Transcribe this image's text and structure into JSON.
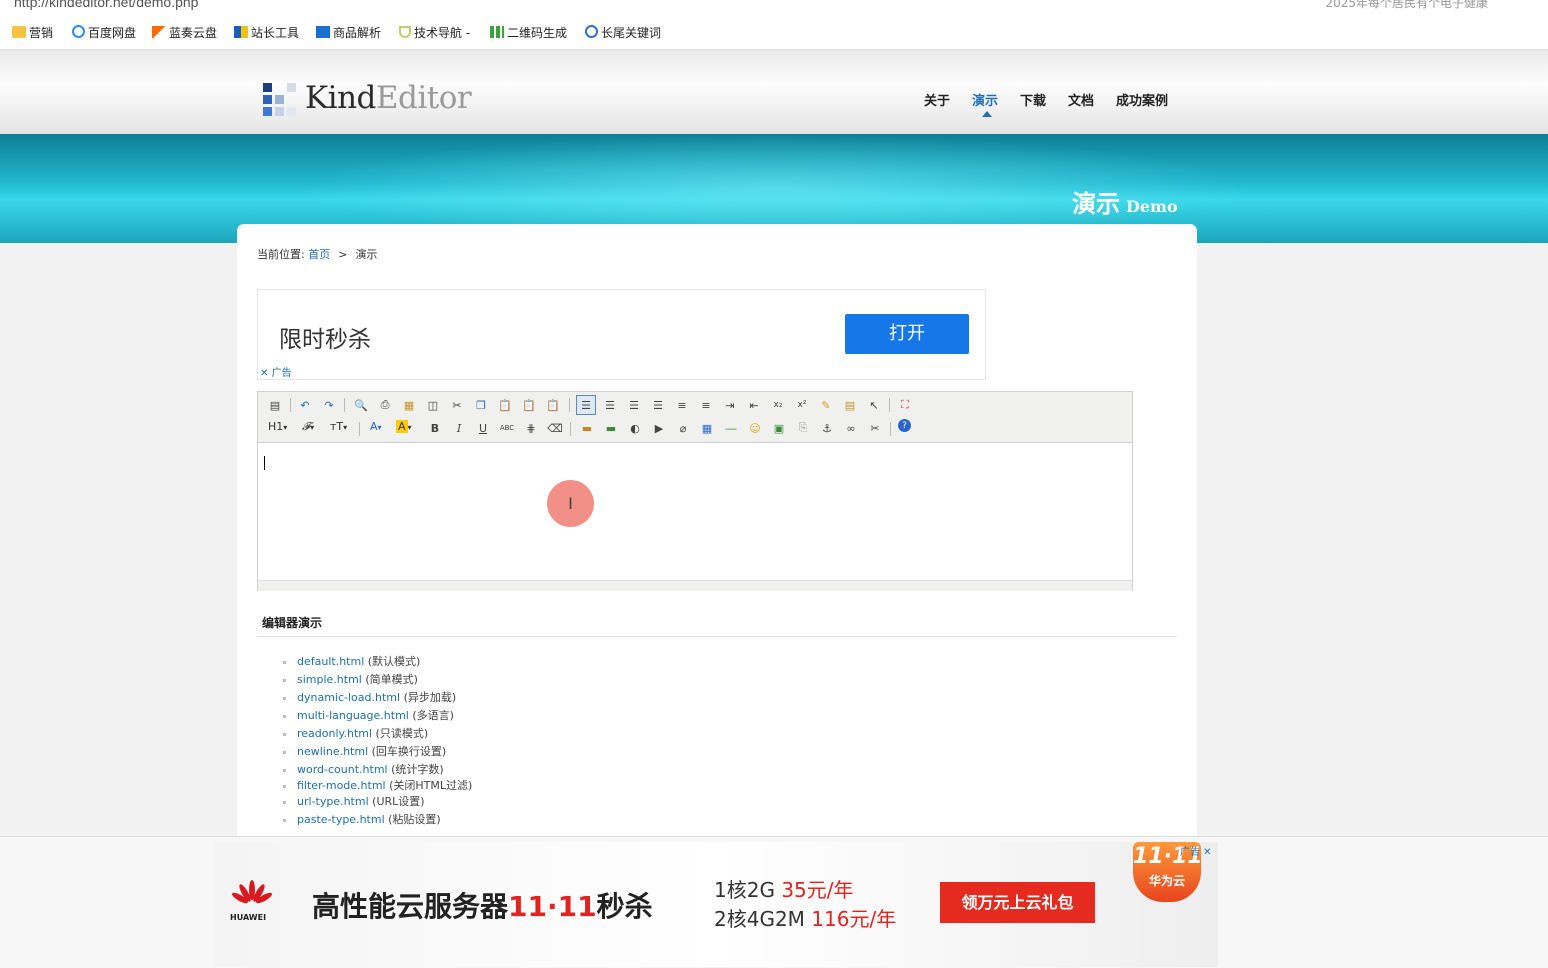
{
  "browser": {
    "url": "http://kindeditor.net/demo.php",
    "right_text": "2025年每个居民有个电子健康"
  },
  "bookmarks": [
    {
      "label": "营销",
      "icon": "folder-icon"
    },
    {
      "label": "百度网盘",
      "icon": "baidu-cloud-icon"
    },
    {
      "label": "蓝奏云盘",
      "icon": "lanzou-icon"
    },
    {
      "label": "站长工具",
      "icon": "chinaz-icon"
    },
    {
      "label": "商品解析",
      "icon": "da-icon"
    },
    {
      "label": "技术导航 -",
      "icon": "shield-icon"
    },
    {
      "label": "二维码生成",
      "icon": "qrcode-icon"
    },
    {
      "label": "长尾关键词",
      "icon": "keyword-icon"
    }
  ],
  "site": {
    "logo_kind": "Kind",
    "logo_editor": "Editor",
    "nav": [
      "关于",
      "演示",
      "下载",
      "文档",
      "成功案例"
    ],
    "active_nav": "演示"
  },
  "banner": {
    "title_cn": "演示",
    "title_en": "Demo"
  },
  "breadcrumb": {
    "label": "当前位置:",
    "home": "首页",
    "separator": ">",
    "current": "演示"
  },
  "ad": {
    "title": "限时秒杀",
    "button": "打开",
    "close_label": "广告"
  },
  "editor": {
    "toolbar_text": {
      "heading": "H1",
      "font": "𝓕",
      "size": "тT",
      "color": "A",
      "hilite": "A",
      "bold": "B",
      "italic": "I",
      "underline": "U",
      "strike": "ABC"
    }
  },
  "section": {
    "title": "编辑器演示"
  },
  "demos": [
    {
      "file": "default.html",
      "desc": "(默认模式)"
    },
    {
      "file": "simple.html",
      "desc": "(简单模式)"
    },
    {
      "file": "dynamic-load.html",
      "desc": "(异步加载)"
    },
    {
      "file": "multi-language.html",
      "desc": "(多语言)"
    },
    {
      "file": "readonly.html",
      "desc": "(只读模式)"
    },
    {
      "file": "newline.html",
      "desc": "(回车换行设置)"
    },
    {
      "file": "word-count.html",
      "desc": "(统计字数)"
    },
    {
      "file": "filter-mode.html",
      "desc": "(关闭HTML过滤)"
    },
    {
      "file": "url-type.html",
      "desc": "(URL设置)"
    },
    {
      "file": "paste-type.html",
      "desc": "(粘贴设置)"
    }
  ],
  "bottom_ad": {
    "brand": "HUAWEI",
    "headline_a": "高性能云服务器",
    "headline_b": "11·11",
    "headline_c": "秒杀",
    "spec1_a": "1核2G ",
    "spec1_b": "35元/年",
    "spec2_a": "2核4G2M ",
    "spec2_b": "116元/年",
    "button": "领万元上云礼包",
    "badge_num": "11·11",
    "badge_sub": "华为云",
    "ad_label": "广告 ✕"
  },
  "colors": {
    "link": "#1f6fb2",
    "banner": "#22b8cf",
    "ad_button": "#1677e8",
    "promo_red": "#e52b1f"
  }
}
